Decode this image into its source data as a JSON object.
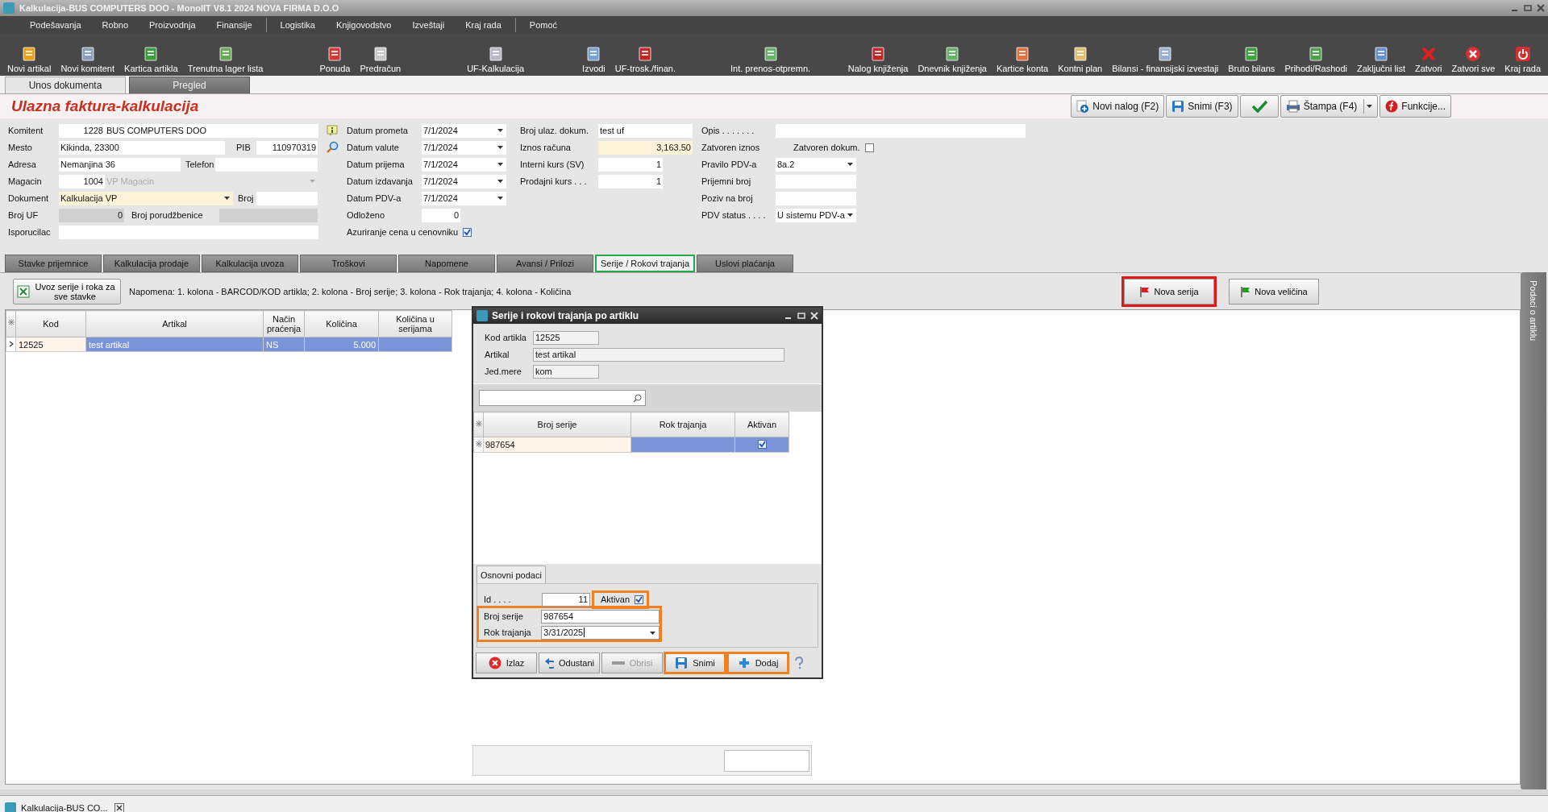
{
  "window": {
    "title": "Kalkulacija-BUS COMPUTERS DOO - MonolIT V8.1 2024 NOVA FIRMA D.O.O"
  },
  "menu_groups": [
    [
      "Podešavanja",
      "Robno",
      "Proizvodnja",
      "Finansije"
    ],
    [
      "Logistika",
      "Knjigovodstvo",
      "Izveštaji",
      "Kraj rada"
    ],
    [
      "Pomoć"
    ]
  ],
  "toolbar_groups": [
    [
      "Novi artikal",
      "Novi komitent",
      "Kartica artikla",
      "Trenutna lager lista"
    ],
    [
      "Ponuda",
      "Predračun"
    ],
    [
      "UF-Kalkulacija"
    ],
    [
      "Izvodi",
      "UF-trosk./finan."
    ],
    [
      "Int. prenos-otpremn."
    ],
    [
      "Nalog knjiženja",
      "Dnevnik knjiženja",
      "Kartice konta",
      "Kontni plan",
      "Bilansi - finansijski izvestaji",
      "Bruto bilans",
      "Prihodi/Rashodi",
      "Zaključni list",
      "Zatvori",
      "Zatvori sve",
      "Kraj rada"
    ]
  ],
  "document_tabs": [
    {
      "label": "Unos dokumenta",
      "selected": true
    },
    {
      "label": "Pregled",
      "selected": false
    }
  ],
  "header": {
    "title": "Ulazna faktura-kalkulacija",
    "buttons": [
      {
        "kind": "new",
        "label": "Novi nalog (F2)"
      },
      {
        "kind": "save",
        "label": "Snimi (F3)"
      },
      {
        "kind": "confirm"
      },
      {
        "kind": "print",
        "label": "Štampa (F4)"
      },
      {
        "kind": "functions",
        "label": "Funkcije..."
      }
    ]
  },
  "form": {
    "komitent": {
      "label": "Komitent",
      "code": "1228",
      "value": "BUS COMPUTERS DOO"
    },
    "mesto": {
      "label": "Mesto",
      "value": "Kikinda, 23300"
    },
    "pib": {
      "label": "PIB",
      "value": "110970319"
    },
    "adresa": {
      "label": "Adresa",
      "value": "Nemanjina 36"
    },
    "telefon": {
      "label": "Telefon"
    },
    "magacin": {
      "label": "Magacin",
      "code": "1004",
      "value": "VP Magacin",
      "disabled": true
    },
    "dokument": {
      "label": "Dokument",
      "value": "Kalkulacija VP"
    },
    "broj": {
      "label": "Broj"
    },
    "broj_uf": {
      "label": "Broj UF",
      "value": "0"
    },
    "broj_porudzbenice": {
      "label": "Broj porudžbenice"
    },
    "isporucilac": {
      "label": "Isporucilac"
    },
    "dates": [
      {
        "label": "Datum prometa",
        "value": "7/1/2024"
      },
      {
        "label": "Datum valute",
        "value": "7/1/2024"
      },
      {
        "label": "Datum prijema",
        "value": "7/1/2024"
      },
      {
        "label": "Datum izdavanja",
        "value": "7/1/2024"
      },
      {
        "label": "Datum PDV-a",
        "value": "7/1/2024"
      }
    ],
    "odlozeno": {
      "label": "Odloženo",
      "value": "0"
    },
    "azuriranje": {
      "label": "Azuriranje cena u cenovniku",
      "checked": true
    },
    "amounts": [
      {
        "label": "Broj ulaz. dokum.",
        "value": "test uf",
        "kind": "text"
      },
      {
        "label": "Iznos računa",
        "value": "3,163.50",
        "kind": "amount"
      },
      {
        "label": "Interni kurs (SV)",
        "value": "1",
        "kind": "rate"
      },
      {
        "label": "Prodajni kurs . . .",
        "value": "1",
        "kind": "rate"
      }
    ],
    "other": [
      {
        "label": "Opis . . . . . . .",
        "kind": "wide"
      },
      {
        "label": "Zatvoren iznos",
        "kind": "none"
      },
      {
        "label": "Pravilo PDV-a",
        "value": "8a.2",
        "kind": "dropdown"
      },
      {
        "label": "Prijemni broj",
        "kind": "text"
      },
      {
        "label": "Poziv na broj",
        "kind": "text"
      },
      {
        "label": "PDV status . . . .",
        "value": "U sistemu PDV-a",
        "kind": "dropdown"
      }
    ],
    "zatvoren_dokum": {
      "label": "Zatvoren dokum.",
      "checked": false
    }
  },
  "detail_tabs": [
    {
      "label": "Stavke  prijemnice",
      "selected": false
    },
    {
      "label": "Kalkulacija prodaje",
      "selected": false
    },
    {
      "label": "Kalkulacija uvoza",
      "selected": false
    },
    {
      "label": "Troškovi",
      "selected": false
    },
    {
      "label": "Napomene",
      "selected": false
    },
    {
      "label": "Avansi / Prilozi",
      "selected": false
    },
    {
      "label": "Serije / Rokovi trajanja",
      "selected": true
    },
    {
      "label": "Uslovi plaćanja",
      "selected": false
    }
  ],
  "import_button": "Uvoz serije i roka za sve stavke",
  "note": "Napomena: 1. kolona - BARCOD/KOD artikla; 2. kolona - Broj serije; 3. kolona - Rok trajanja; 4. kolona - Količina",
  "action_buttons": [
    {
      "kind": "red",
      "label": "Nova serija",
      "highlighted": true
    },
    {
      "kind": "green",
      "label": "Nova veličina",
      "highlighted": false
    }
  ],
  "items_table": {
    "columns": [
      "Kod",
      "Artikal",
      "Način praćenja",
      "Količina",
      "Količina u serijama"
    ],
    "rows": [
      {
        "cells": [
          "12525",
          "test artikal",
          "NS",
          "5.000",
          ""
        ],
        "selected": true
      }
    ]
  },
  "side_tab": "Podaci o artiklu",
  "dialog": {
    "title": "Serije i rokovi trajanja po artiklu",
    "fields": [
      {
        "label": "Kod artikla",
        "value": "12525",
        "kind": "short"
      },
      {
        "label": "Artikal",
        "value": "test artikal",
        "kind": "long"
      },
      {
        "label": "Jed.mere",
        "value": "kom",
        "kind": "short"
      }
    ],
    "columns": [
      "Broj serije",
      "Rok trajanja",
      "Aktivan"
    ],
    "rows": [
      {
        "broj_serije": "987654",
        "aktivan": true,
        "selected": true
      }
    ],
    "tab": "Osnovni podaci",
    "id": {
      "label": "Id . . . .",
      "value": "11"
    },
    "aktivan": {
      "label": "Aktivan",
      "checked": true,
      "highlighted": true
    },
    "broj_serije": {
      "label": "Broj serije",
      "value": "987654"
    },
    "rok_trajanja": {
      "label": "Rok trajanja",
      "value": "3/31/2025"
    },
    "serie_highlighted": true,
    "buttons": [
      {
        "kind": "exit",
        "label": "Izlaz",
        "disabled": false,
        "highlighted": false
      },
      {
        "kind": "undo",
        "label": "Odustani",
        "disabled": false,
        "highlighted": false
      },
      {
        "kind": "delete",
        "label": "Obrisi",
        "disabled": true,
        "highlighted": false
      },
      {
        "kind": "save",
        "label": "Snimi",
        "disabled": false,
        "highlighted": true
      },
      {
        "kind": "add",
        "label": "Dodaj",
        "disabled": false,
        "highlighted": true
      }
    ]
  },
  "taskbar": {
    "item": "Kalkulacija-BUS CO..."
  }
}
